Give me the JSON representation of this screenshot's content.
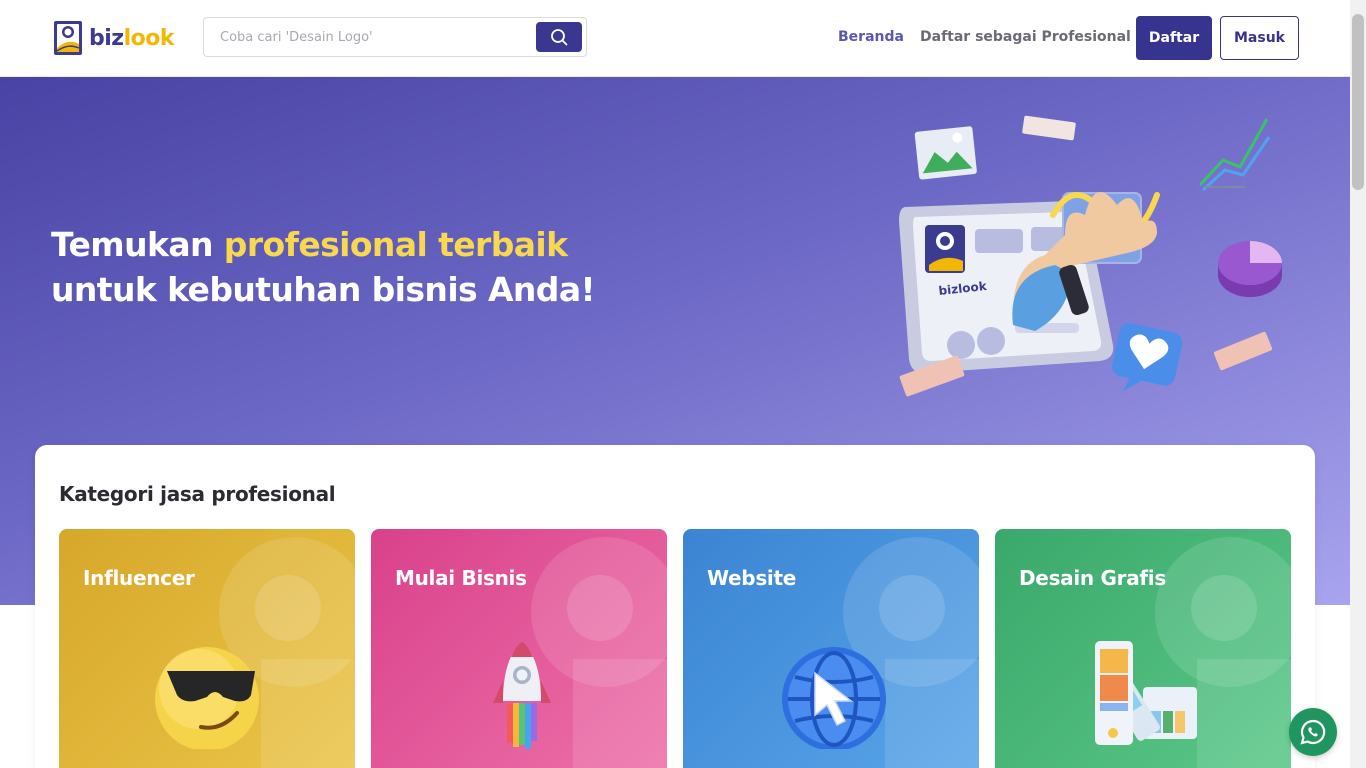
{
  "header": {
    "logo": {
      "part1": "biz",
      "part2": "look"
    },
    "search": {
      "placeholder": "Coba cari 'Desain Logo'",
      "value": ""
    },
    "nav": {
      "home": "Beranda",
      "register_pro": "Daftar sebagai Profesional"
    },
    "buttons": {
      "register": "Daftar",
      "login": "Masuk"
    }
  },
  "hero": {
    "title_part1": "Temukan ",
    "title_highlight": "profesional terbaik",
    "title_line2": "untuk kebutuhan bisnis Anda!",
    "illustration_logo_text": "bizlook"
  },
  "categories": {
    "title": "Kategori jasa profesional",
    "items": [
      {
        "label": "Influencer",
        "icon": "sunglasses-emoji-icon"
      },
      {
        "label": "Mulai Bisnis",
        "icon": "rocket-icon"
      },
      {
        "label": "Website",
        "icon": "globe-cursor-icon"
      },
      {
        "label": "Desain Grafis",
        "icon": "color-palette-icon"
      }
    ]
  },
  "colors": {
    "primary": "#36348e",
    "highlight": "#f7d84e",
    "whatsapp": "#21955f"
  }
}
